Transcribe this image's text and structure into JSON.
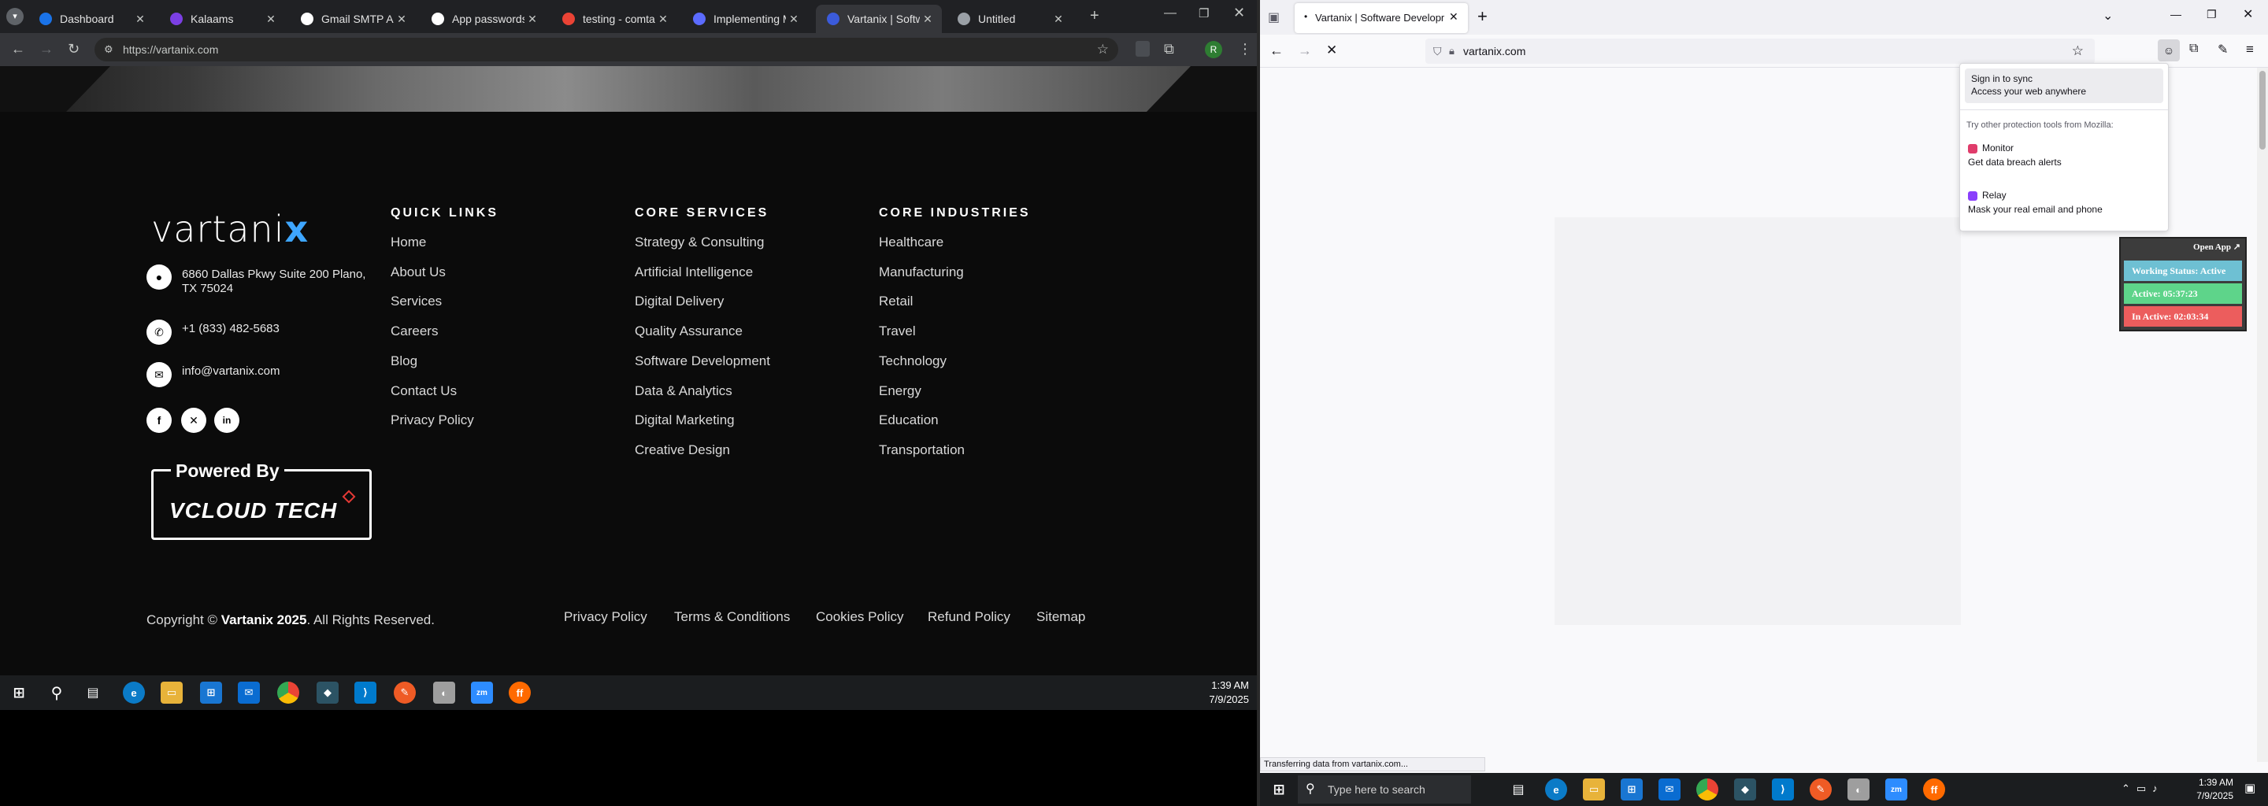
{
  "chrome": {
    "tabs": [
      {
        "title": "Dashboard",
        "icon": "globe-icon",
        "color": "#1a73e8"
      },
      {
        "title": "Kalaams",
        "icon": "kalaams-icon",
        "color": "#7b3fe4"
      },
      {
        "title": "Gmail SMTP Auth",
        "icon": "google-icon",
        "color": "#ffffff"
      },
      {
        "title": "App passwords",
        "icon": "google-icon",
        "color": "#ffffff"
      },
      {
        "title": "testing - comtan",
        "icon": "gmail-icon",
        "color": "#ea4335"
      },
      {
        "title": "Implementing Ma",
        "icon": "site-icon",
        "color": "#5b6bff"
      },
      {
        "title": "Vartanix | Softwar",
        "icon": "vartanix-icon",
        "color": "#3b5bdb"
      },
      {
        "title": "Untitled",
        "icon": "globe-icon",
        "color": "#9aa0a6"
      }
    ],
    "url": "https://vartanix.com",
    "profile_initial": "R"
  },
  "footer": {
    "logo_text": "vartani",
    "logo_x": "x",
    "address": "6860 Dallas Pkwy Suite 200 Plano, TX 75024",
    "phone": "+1 (833) 482-5683",
    "email": "info@vartanix.com",
    "powered_by": "Powered By",
    "vcloud": "VCLOUD TECH",
    "quick_links_title": "QUICK LINKS",
    "quick_links": [
      "Home",
      "About Us",
      "Services",
      "Careers",
      "Blog",
      "Contact Us",
      "Privacy Policy"
    ],
    "services_title": "CORE SERVICES",
    "services": [
      "Strategy & Consulting",
      "Artificial Intelligence",
      "Digital Delivery",
      "Quality Assurance",
      "Software Development",
      "Data & Analytics",
      "Digital Marketing",
      "Creative Design"
    ],
    "industries_title": "CORE INDUSTRIES",
    "industries": [
      "Healthcare",
      "Manufacturing",
      "Retail",
      "Travel",
      "Technology",
      "Energy",
      "Education",
      "Transportation"
    ],
    "copyright_prefix": "Copyright ©",
    "copyright_brand": "Vartanix 2025",
    "copyright_suffix": ". All Rights Reserved.",
    "bottom_links": [
      "Privacy Policy",
      "Terms & Conditions",
      "Cookies Policy",
      "Refund Policy",
      "Sitemap"
    ]
  },
  "taskbar": {
    "time": "1:39 AM",
    "date": "7/9/2025",
    "search_placeholder": "Type here to search"
  },
  "firefox": {
    "tab_title": "Vartanix | Software Developme",
    "url": "vartanix.com",
    "status": "Transferring data from vartanix.com...",
    "menu": {
      "sync_title": "Sign in to sync",
      "sync_sub": "Access your web anywhere",
      "other_tools": "Try other protection tools from Mozilla:",
      "monitor_title": "Monitor",
      "monitor_sub": "Get data breach alerts",
      "relay_title": "Relay",
      "relay_sub": "Mask your real email and phone"
    },
    "widget": {
      "open_app": "Open App ↗",
      "working": "Working Status: Active",
      "active": "Active: 05:37:23",
      "inactive": "In Active: 02:03:34"
    }
  },
  "colors": {
    "working": "#6ec0d3",
    "active": "#5ed48a",
    "inactive": "#ec5d5d"
  }
}
